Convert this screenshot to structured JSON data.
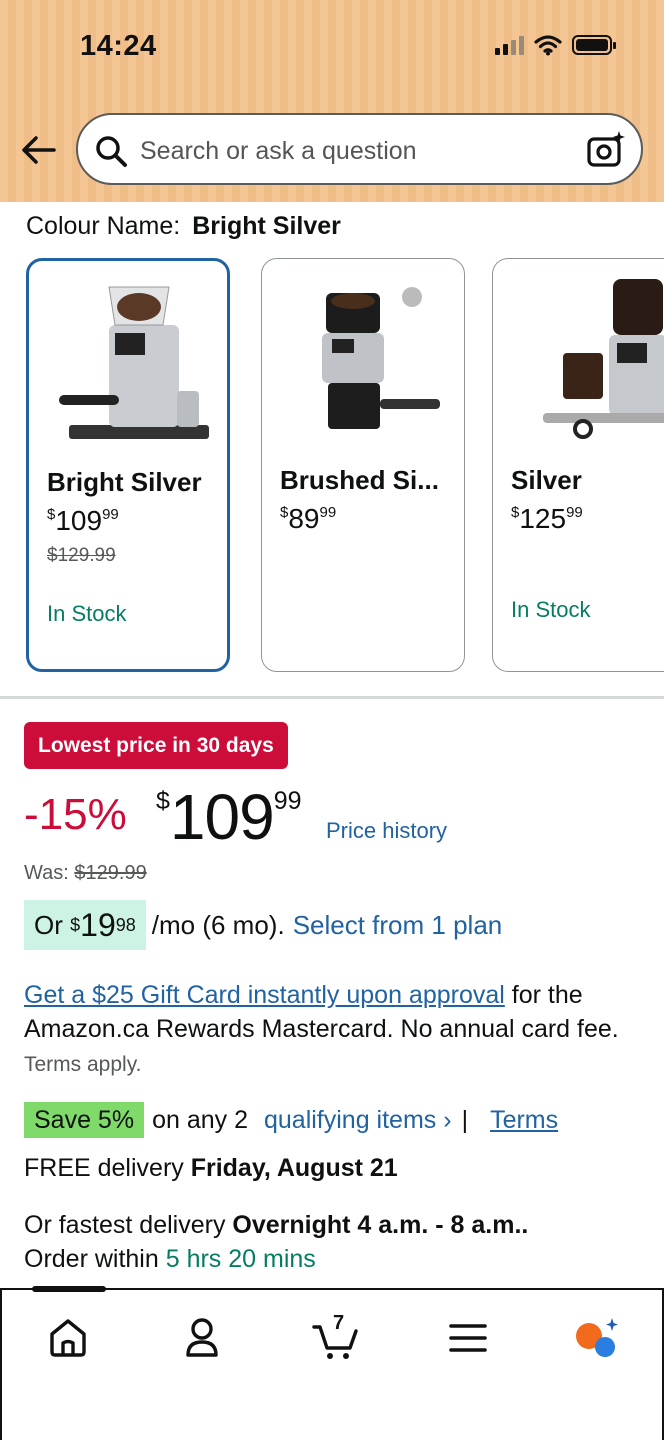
{
  "status_bar": {
    "time": "14:24"
  },
  "search": {
    "placeholder": "Search or ask a question"
  },
  "colour": {
    "label": "Colour Name:",
    "value": "Bright Silver"
  },
  "variants": [
    {
      "name": "Bright Silver",
      "currency": "$",
      "price_whole": "109",
      "price_fraction": "99",
      "was": "$129.99",
      "stock": "In Stock"
    },
    {
      "name": "Brushed Si...",
      "currency": "$",
      "price_whole": "89",
      "price_fraction": "99",
      "was": "",
      "stock": ""
    },
    {
      "name": "Silver",
      "currency": "$",
      "price_whole": "125",
      "price_fraction": "99",
      "was": "",
      "stock": "In Stock"
    }
  ],
  "deal": {
    "badge": "Lowest price in 30 days",
    "discount": "-15%",
    "currency": "$",
    "price_whole": "109",
    "price_fraction": "99",
    "history_link": "Price history",
    "was_label": "Was:",
    "was_price": "$129.99"
  },
  "monthly": {
    "prefix": "Or",
    "currency": "$",
    "whole": "19",
    "fraction": "98",
    "suffix": "/mo (6 mo).",
    "plan_link": "Select from 1 plan"
  },
  "gift": {
    "link": "Get a $25 Gift Card instantly upon approval",
    "text": " for the Amazon.ca Rewards Mastercard. No annual card fee.",
    "terms": "Terms apply."
  },
  "save": {
    "badge": "Save 5%",
    "text": "on any 2",
    "link": "qualifying items ›",
    "separator": "|",
    "terms": "Terms"
  },
  "delivery": {
    "prefix": "FREE delivery",
    "date": "Friday, August 21"
  },
  "fastest": {
    "prefix": "Or fastest delivery",
    "window": "Overnight 4 a.m. - 8 a.m..",
    "order_prefix": "Order within",
    "countdown": "5 hrs 20 mins"
  },
  "nav": {
    "cart_count": "7"
  }
}
